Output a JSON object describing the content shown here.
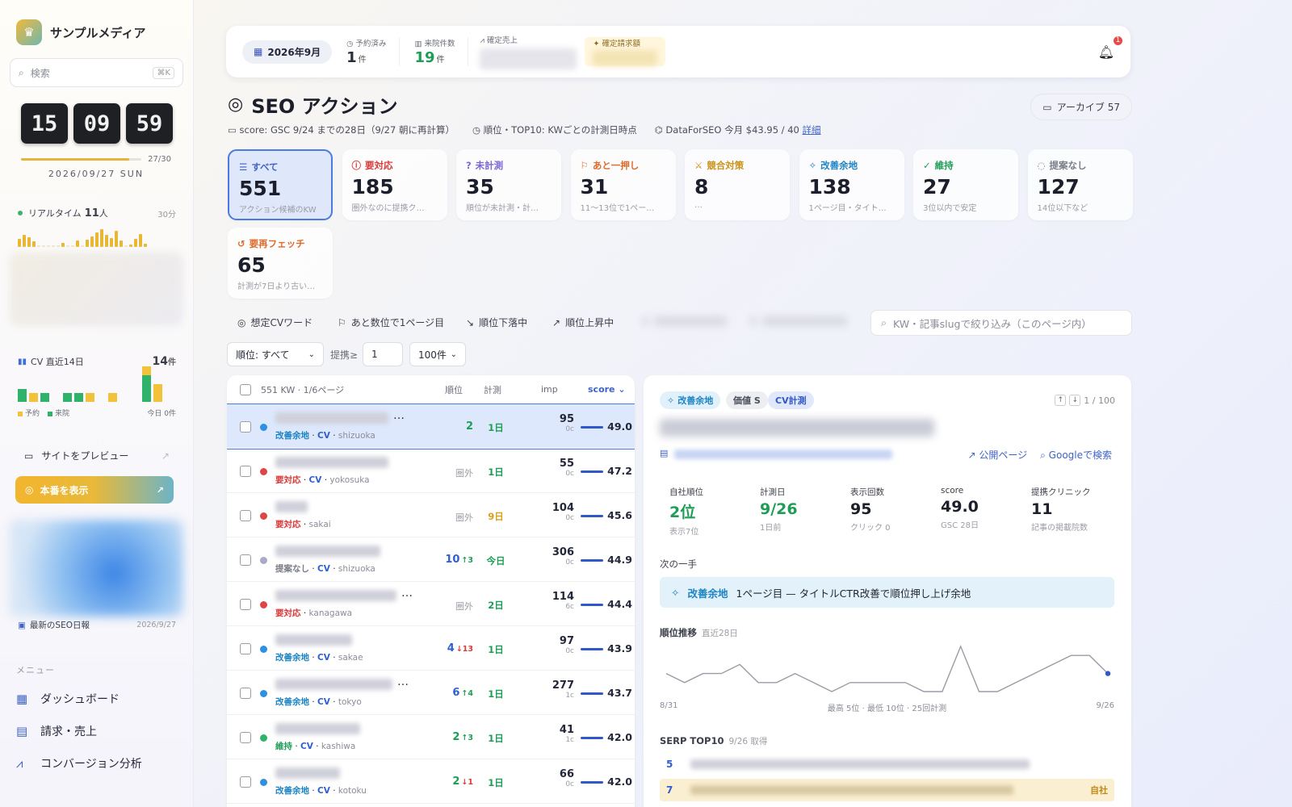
{
  "sidebar": {
    "brand": "サンプルメディア",
    "search_placeholder": "検索",
    "search_kbd": "⌘K",
    "clock": {
      "h": "15",
      "m": "09",
      "s": "59"
    },
    "month_progress": {
      "label": "27/30",
      "fraction": 0.9
    },
    "date": "2026/09/27 SUN",
    "realtime": {
      "label": "リアルタイム",
      "count": "11",
      "unit": "人",
      "window": "30分",
      "bars": [
        9,
        14,
        11,
        6,
        0,
        0,
        0,
        0,
        0,
        5,
        0,
        0,
        7,
        0,
        8,
        12,
        16,
        20,
        14,
        10,
        18,
        7,
        0,
        3,
        9,
        15,
        4
      ]
    },
    "cv": {
      "label": "CV 直近14日",
      "count": "14",
      "unit": "件",
      "days": [
        {
          "r": 0,
          "v": 3
        },
        {
          "r": 2,
          "v": 0
        },
        {
          "r": 0,
          "v": 2
        },
        {
          "r": 0,
          "v": 0
        },
        {
          "r": 0,
          "v": 2
        },
        {
          "r": 0,
          "v": 2
        },
        {
          "r": 2,
          "v": 0
        },
        {
          "r": 0,
          "v": 0
        },
        {
          "r": 2,
          "v": 0
        },
        {
          "r": 0,
          "v": 0
        },
        {
          "r": 0,
          "v": 0
        },
        {
          "r": 2,
          "v": 6
        },
        {
          "r": 4,
          "v": 0
        }
      ],
      "legend_reserved": "予約",
      "legend_visited": "来院",
      "today": "今日 0件"
    },
    "preview_label": "サイトをプレビュー",
    "live_label": "本番を表示",
    "report_label": "最新のSEO日報",
    "report_date": "2026/9/27",
    "menu_heading": "メニュー",
    "nav": [
      {
        "label": "ダッシュボード",
        "icon": "grid-icon"
      },
      {
        "label": "請求・売上",
        "icon": "invoice-icon"
      },
      {
        "label": "コンバージョン分析",
        "icon": "chart-line-icon"
      }
    ]
  },
  "topbar": {
    "month": "2026年9月",
    "reserved_label": "予約済み",
    "reserved_value": "1",
    "visits_label": "来院件数",
    "visits_value": "19",
    "unit": "件",
    "sales_label": "確定売上",
    "billing_label": "確定請求額",
    "notifications": "1"
  },
  "header": {
    "title": "SEO アクション",
    "archive": "アーカイブ 57",
    "meta_score": "score: GSC 9/24 までの28日（9/27 朝に再計算）",
    "meta_rank": "順位・TOP10: KWごとの計測日時点",
    "meta_dfs": "DataForSEO 今月 $43.95 / 40",
    "meta_link": "詳細"
  },
  "filters": [
    {
      "label": "すべて",
      "count": "551",
      "sub": "アクション候補のKW",
      "color": "#3f63c8",
      "icon": "list-icon",
      "active": true
    },
    {
      "label": "要対応",
      "count": "185",
      "sub": "圏外なのに提携ク…",
      "color": "#d93a3a",
      "icon": "alert-icon"
    },
    {
      "label": "未計測",
      "count": "35",
      "sub": "順位が未計測・計…",
      "color": "#7c65d6",
      "icon": "question-icon"
    },
    {
      "label": "あと一押し",
      "count": "31",
      "sub": "11〜13位で1ペー…",
      "color": "#e06a2a",
      "icon": "flag-icon"
    },
    {
      "label": "競合対策",
      "count": "8",
      "sub": "…",
      "color": "#c9921a",
      "icon": "sword-icon"
    },
    {
      "label": "改善余地",
      "count": "138",
      "sub": "1ページ目・タイト…",
      "color": "#1e84c4",
      "icon": "sparkle-icon"
    },
    {
      "label": "維持",
      "count": "27",
      "sub": "3位以内で安定",
      "color": "#1f9d57",
      "icon": "check-icon"
    },
    {
      "label": "提案なし",
      "count": "127",
      "sub": "14位以下など",
      "color": "#7a7d88",
      "icon": "dashed-circle-icon"
    },
    {
      "label": "要再フェッチ",
      "count": "65",
      "sub": "計測が7日より古い…",
      "color": "#e06a2a",
      "icon": "history-icon"
    }
  ],
  "quick_filters": [
    {
      "label": "想定CVワード",
      "icon": "target-icon"
    },
    {
      "label": "あと数位で1ページ目",
      "icon": "flag-icon"
    },
    {
      "label": "順位下落中",
      "icon": "trend-down-icon"
    },
    {
      "label": "順位上昇中",
      "icon": "trend-up-icon"
    }
  ],
  "kw_search_placeholder": "KW・記事slugで絞り込み（このページ内）",
  "controls": {
    "rank_select": "順位: すべて",
    "teian_label": "提携≥",
    "teian_value": "1",
    "per_page": "100件"
  },
  "table": {
    "summary": "551 KW · 1/6ページ",
    "col_rank": "順位",
    "col_meas": "計測",
    "col_imp": "imp",
    "col_score": "score ⌄",
    "rows": [
      {
        "dot": "#2f8fe0",
        "kwlen": 140,
        "ell": true,
        "tag": "改善余地",
        "tagc": "#1e84c4",
        "cv": "CV",
        "city": "shizuoka",
        "rank": "2",
        "rankc": "#1f9d57",
        "delta": "",
        "dc": "",
        "meas": "1日",
        "measc": "#1f9d57",
        "imp": "95",
        "clk": "0c",
        "score": "49.0",
        "selected": true
      },
      {
        "dot": "#e04545",
        "kwlen": 140,
        "ell": false,
        "tag": "要対応",
        "tagc": "#d93a3a",
        "cv": "CV",
        "city": "yokosuka",
        "rank": "圏外",
        "rankc": "#9a9ca6",
        "delta": "",
        "dc": "",
        "meas": "1日",
        "measc": "#1f9d57",
        "imp": "55",
        "clk": "0c",
        "score": "47.2"
      },
      {
        "dot": "#e04545",
        "kwlen": 40,
        "ell": false,
        "tag": "要対応",
        "tagc": "#d93a3a",
        "cv": "",
        "city": "sakai",
        "rank": "圏外",
        "rankc": "#9a9ca6",
        "delta": "",
        "dc": "",
        "meas": "9日",
        "measc": "#d9a21a",
        "imp": "104",
        "clk": "0c",
        "score": "45.6"
      },
      {
        "dot": "#a9a9c9",
        "kwlen": 130,
        "ell": false,
        "tag": "提案なし",
        "tagc": "#7a7d88",
        "cv": "CV",
        "city": "shizuoka",
        "rank": "10",
        "rankc": "#2f5fd0",
        "delta": "↑3",
        "dc": "#1f9d57",
        "meas": "今日",
        "measc": "#1f9d57",
        "imp": "306",
        "clk": "0c",
        "score": "44.9"
      },
      {
        "dot": "#e04545",
        "kwlen": 150,
        "ell": true,
        "tag": "要対応",
        "tagc": "#d93a3a",
        "cv": "",
        "city": "kanagawa",
        "rank": "圏外",
        "rankc": "#9a9ca6",
        "delta": "",
        "dc": "",
        "meas": "2日",
        "measc": "#1f9d57",
        "imp": "114",
        "clk": "6c",
        "score": "44.4"
      },
      {
        "dot": "#2f8fe0",
        "kwlen": 95,
        "ell": false,
        "tag": "改善余地",
        "tagc": "#1e84c4",
        "cv": "CV",
        "city": "sakae",
        "rank": "4",
        "rankc": "#2f5fd0",
        "delta": "↓13",
        "dc": "#d93a3a",
        "meas": "1日",
        "measc": "#1f9d57",
        "imp": "97",
        "clk": "0c",
        "score": "43.9"
      },
      {
        "dot": "#2f8fe0",
        "kwlen": 145,
        "ell": true,
        "tag": "改善余地",
        "tagc": "#1e84c4",
        "cv": "CV",
        "city": "tokyo",
        "rank": "6",
        "rankc": "#2f5fd0",
        "delta": "↑4",
        "dc": "#1f9d57",
        "meas": "1日",
        "measc": "#1f9d57",
        "imp": "277",
        "clk": "1c",
        "score": "43.7"
      },
      {
        "dot": "#2fb36b",
        "kwlen": 105,
        "ell": false,
        "tag": "維持",
        "tagc": "#1f9d57",
        "cv": "CV",
        "city": "kashiwa",
        "rank": "2",
        "rankc": "#1f9d57",
        "delta": "↑3",
        "dc": "#1f9d57",
        "meas": "1日",
        "measc": "#1f9d57",
        "imp": "41",
        "clk": "1c",
        "score": "42.0"
      },
      {
        "dot": "#2f8fe0",
        "kwlen": 80,
        "ell": false,
        "tag": "改善余地",
        "tagc": "#1e84c4",
        "cv": "CV",
        "city": "kotoku",
        "rank": "2",
        "rankc": "#1f9d57",
        "delta": "↓1",
        "dc": "#d93a3a",
        "meas": "1日",
        "measc": "#1f9d57",
        "imp": "66",
        "clk": "0c",
        "score": "42.0"
      }
    ]
  },
  "detail": {
    "chips": [
      {
        "label": "改善余地",
        "bg": "#e0f1fb",
        "fg": "#1e84c4",
        "icon": "sparkle-icon"
      },
      {
        "label": "価値 S",
        "bg": "#eceef2",
        "fg": "#4a4d5a"
      },
      {
        "label": "CV計測",
        "bg": "#e2e8fb",
        "fg": "#3158c8"
      }
    ],
    "pager": "1 / 100",
    "link_public": "公開ページ",
    "link_google": "Googleで検索",
    "kpis": [
      {
        "label": "自社順位",
        "value": "2位",
        "sub": "表示7位",
        "green": true
      },
      {
        "label": "計測日",
        "value": "9/26",
        "sub": "1日前",
        "green": true
      },
      {
        "label": "表示回数",
        "value": "95",
        "sub": "クリック 0"
      },
      {
        "label": "score",
        "value": "49.0",
        "sub": "GSC 28日"
      },
      {
        "label": "提携クリニック",
        "value": "11",
        "sub": "記事の掲載院数"
      }
    ],
    "next_label": "次の一手",
    "next_tag": "改善余地",
    "next_text": "1ページ目 — タイトルCTR改善で順位押し上げ余地",
    "rank_title": "順位推移",
    "rank_sub": "直近28日",
    "rank_start": "8/31",
    "rank_end": "9/26",
    "rank_summary": "最高 5位 · 最低 10位 · 25回計測",
    "serp_title": "SERP TOP10",
    "serp_sub": "9/26 取得",
    "serp": [
      {
        "pos": "5",
        "own": ""
      },
      {
        "pos": "7",
        "own": "自社"
      }
    ]
  },
  "chart_data": {
    "type": "line",
    "x": [
      "8/31",
      "9/1",
      "9/2",
      "9/3",
      "9/4",
      "9/5",
      "9/6",
      "9/7",
      "9/8",
      "9/9",
      "9/10",
      "9/11",
      "9/12",
      "9/13",
      "9/14",
      "9/15",
      "9/16",
      "9/17",
      "9/18",
      "9/19",
      "9/20",
      "9/21",
      "9/22",
      "9/23",
      "9/26"
    ],
    "series": [
      {
        "values": [
          8,
          9,
          8,
          8,
          7,
          9,
          9,
          8,
          9,
          10,
          9,
          9,
          9,
          9,
          10,
          10,
          5,
          10,
          10,
          9,
          8,
          7,
          6,
          6,
          8
        ]
      }
    ],
    "ylim": [
      10,
      5
    ],
    "grid": false
  }
}
